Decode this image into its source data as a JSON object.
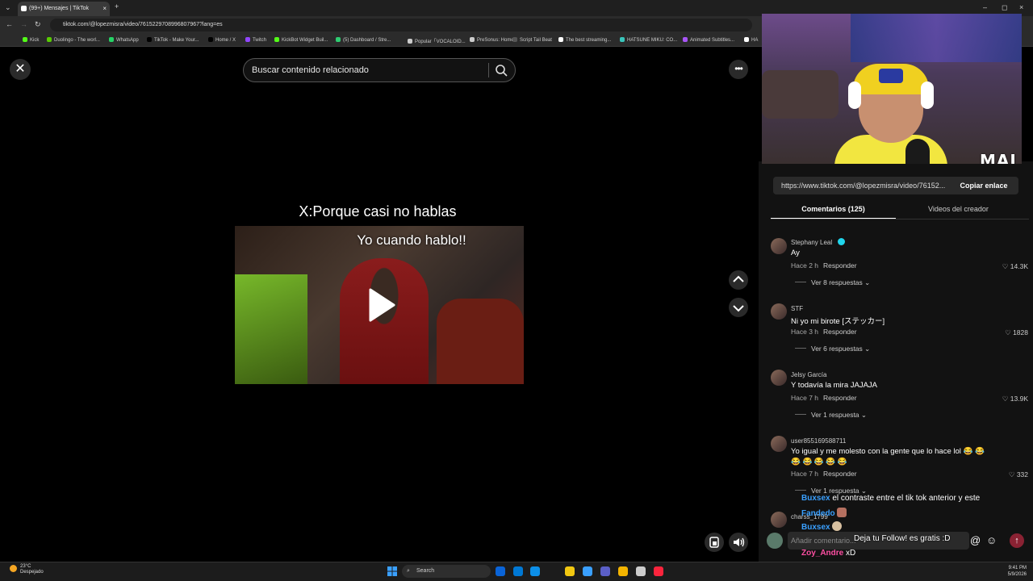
{
  "browser": {
    "tab_title": "(99+) Mensajes | TikTok",
    "tab_close": "×",
    "new_tab": "+",
    "url": "tiktok.com/@lopezmisra/video/7615229708996807967?lang=es",
    "window_controls": [
      "–",
      "◻",
      "×"
    ],
    "bookmarks": [
      {
        "label": "Kick",
        "color": "#53fc18"
      },
      {
        "label": "Duolingo - The worl...",
        "color": "#58cc02"
      },
      {
        "label": "WhatsApp",
        "color": "#25d366"
      },
      {
        "label": "TikTok - Make Your...",
        "color": "#000000"
      },
      {
        "label": "Home / X",
        "color": "#000000"
      },
      {
        "label": "Twitch",
        "color": "#9146ff"
      },
      {
        "label": "KickBot Widget Buil...",
        "color": "#53fc18"
      },
      {
        "label": "(5) Dashboard / Stre...",
        "color": "#2ecc71"
      },
      {
        "label": "Popular「VOCALOID...",
        "color": "#cccccc"
      },
      {
        "label": "PreSonus: Home",
        "color": "#cccccc"
      },
      {
        "label": "Script Tail Beat",
        "color": "#555555"
      },
      {
        "label": "The best streaming...",
        "color": "#ffffff"
      },
      {
        "label": "HATSUNE MIKU: CO...",
        "color": "#39c5bb"
      },
      {
        "label": "Animated Subtitles...",
        "color": "#a855f7"
      },
      {
        "label": "HA",
        "color": "#ffffff"
      }
    ]
  },
  "viewer": {
    "close_icon": "✕",
    "search_placeholder": "Buscar contenido relacionado",
    "more_icon": "•••",
    "video_caption": "X:Porque casi no hablas",
    "video_overlay_text": "Yo cuando hablo!!"
  },
  "panel": {
    "link": "https://www.tiktok.com/@lopezmisra/video/76152...",
    "copy_link": "Copiar enlace",
    "tab_comments": "Comentarios (125)",
    "tab_creator": "Videos del creador",
    "comments": [
      {
        "user": "Stephany Leal",
        "text": "Ay",
        "time": "Hace 2 h",
        "reply": "Responder",
        "likes": "14.3K",
        "more": "Ver 8 respuestas"
      },
      {
        "user": "STF",
        "text": "Ni yo mi birote [ステッカー]",
        "time": "Hace 3 h",
        "reply": "Responder",
        "likes": "1828",
        "more": "Ver 6 respuestas"
      },
      {
        "user": "Jelsy García",
        "text": "Y todavía la mira JAJAJA",
        "time": "Hace 7 h",
        "reply": "Responder",
        "likes": "13.9K",
        "more": "Ver 1 respuesta"
      },
      {
        "user": "user855169588711",
        "text": "Yo igual y me molesto con la gente que lo hace lol 😂 😂",
        "text2": "😂 😂 😂 😂 😂",
        "time": "Hace 7 h",
        "reply": "Responder",
        "likes": "332",
        "more": "Ver 1 respuesta"
      },
      {
        "user": "charss_1799"
      }
    ],
    "comment_placeholder": "Añadir comentario...",
    "mention_icon": "@",
    "emoji_icon": "☺",
    "send_icon": "↑"
  },
  "stream_overlay": {
    "chat": [
      {
        "user": "Buxsex",
        "msg": "el contraste entre el tik tok anterior y este"
      },
      {
        "user": "Fandedo",
        "msg": ""
      },
      {
        "user": "Buxsex",
        "msg": ""
      },
      {
        "user": "Zoy_Andre",
        "msg": "xD"
      }
    ],
    "follow_text": "Deja tu Follow! es gratis :D",
    "webcam_brand": "MAI"
  },
  "taskbar": {
    "weather_temp": "23°C",
    "weather_desc": "Despejado",
    "search_label": "Search",
    "time": "9:41 PM",
    "date": "5/9/2026",
    "apps": [
      "#0a64d8",
      "#0078d4",
      "#0c8fe8",
      "#f2c811",
      "#3aa0ff",
      "#5b5fc7",
      "#f4b400",
      "#cccccc",
      "#fa243c"
    ]
  }
}
